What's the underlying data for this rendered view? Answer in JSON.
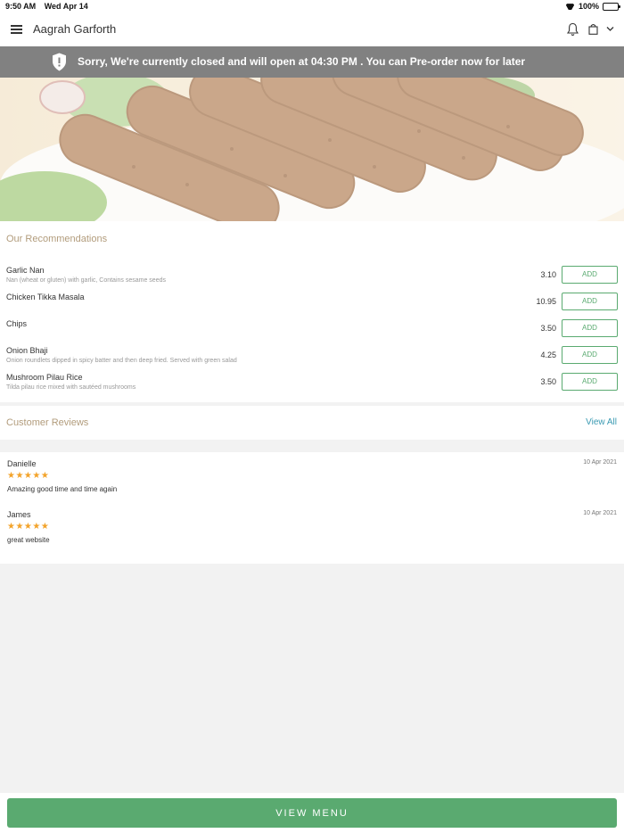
{
  "status_bar": {
    "time": "9:50 AM",
    "date": "Wed Apr 14",
    "battery": "100%"
  },
  "header": {
    "title": "Aagrah Garforth"
  },
  "banner": {
    "message": "Sorry, We're currently closed and will open at 04:30 PM . You can Pre-order now for later"
  },
  "recommendations": {
    "title": "Our Recommendations",
    "add_label": "ADD",
    "items": [
      {
        "name": "Garlic Nan",
        "description": "Nan (wheat or gluten) with garlic, Contains sesame seeds",
        "price": "3.10"
      },
      {
        "name": "Chicken Tikka Masala",
        "description": "",
        "price": "10.95"
      },
      {
        "name": "Chips",
        "description": "",
        "price": "3.50"
      },
      {
        "name": "Onion Bhaji",
        "description": "Onion roundlets dipped in spicy batter and then deep fried. Served with green salad",
        "price": "4.25"
      },
      {
        "name": "Mushroom Pilau Rice",
        "description": "Tilda pilau rice mixed with sautéed mushrooms",
        "price": "3.50"
      }
    ]
  },
  "reviews": {
    "title": "Customer Reviews",
    "view_all": "View All",
    "items": [
      {
        "name": "Danielle",
        "date": "10 Apr 2021",
        "rating": 5,
        "stars": "★★★★★",
        "text": "Amazing good time and time again"
      },
      {
        "name": "James",
        "date": "10 Apr 2021",
        "rating": 5,
        "stars": "★★★★★",
        "text": "great website"
      }
    ]
  },
  "footer": {
    "view_menu": "VIEW MENU"
  },
  "colors": {
    "accent_green": "#5aaa70",
    "section_title": "#b29c7c",
    "link_blue": "#3a9ab2",
    "banner_gray": "#818181",
    "star": "#f3a32a"
  }
}
